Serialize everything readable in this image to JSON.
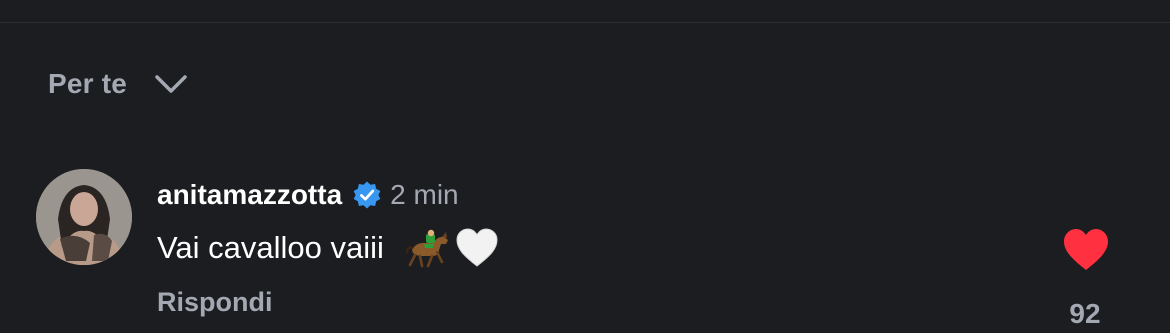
{
  "filter": {
    "label": "Per te",
    "chevron_icon": "chevron-down-icon"
  },
  "comment": {
    "username": "anitamazzotta",
    "verified": true,
    "verified_icon": "verified-badge-icon",
    "timestamp": "2 min",
    "text": "Vai cavalloo vaiii",
    "emojis": [
      "horse-racing-emoji",
      "white-heart-emoji"
    ],
    "reply_label": "Rispondi",
    "liked": true,
    "like_icon": "heart-icon",
    "like_count": "92"
  },
  "colors": {
    "background": "#1c1d20",
    "text_primary": "#ffffff",
    "text_secondary": "#a3a8b2",
    "verified_blue": "#3897f0",
    "like_red": "#ff3040"
  }
}
